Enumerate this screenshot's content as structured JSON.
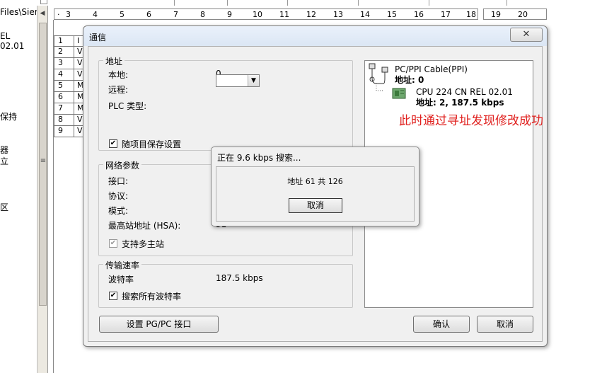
{
  "background": {
    "path_fragment": "Files\\Siem",
    "side_labels": [
      "EL 02.01",
      "保持",
      "器",
      "立",
      "区"
    ],
    "ruler_numbers": [
      "3",
      "4",
      "5",
      "6",
      "7",
      "8",
      "9",
      "10",
      "11",
      "12",
      "13",
      "14",
      "15",
      "16",
      "17",
      "18"
    ],
    "ruler_numbers_right": [
      "19",
      "20"
    ],
    "table_rows": [
      {
        "num": "1",
        "ch": "I"
      },
      {
        "num": "2",
        "ch": "V"
      },
      {
        "num": "3",
        "ch": "V"
      },
      {
        "num": "4",
        "ch": "V"
      },
      {
        "num": "5",
        "ch": "M"
      },
      {
        "num": "6",
        "ch": "M"
      },
      {
        "num": "7",
        "ch": "M"
      },
      {
        "num": "8",
        "ch": "V"
      },
      {
        "num": "9",
        "ch": "V"
      }
    ]
  },
  "dialog": {
    "title": "通信",
    "close_glyph": "✕",
    "address_group": {
      "legend": "地址",
      "local_label": "本地:",
      "local_value": "0",
      "remote_label": "远程:",
      "plc_type_label": "PLC 类型:",
      "save_with_project_label": "随项目保存设置",
      "save_with_project_checked": true
    },
    "network_group": {
      "legend": "网络参数",
      "interface_label": "接口:",
      "protocol_label": "协议:",
      "mode_label": "模式:",
      "hsa_label": "最高站地址 (HSA):",
      "hsa_value": "31",
      "multi_master_label": "支持多主站",
      "multi_master_checked": true
    },
    "rate_group": {
      "legend": "传输速率",
      "baud_label": "波特率",
      "baud_value": "187.5 kbps",
      "search_all_label": "搜索所有波特率",
      "search_all_checked": true
    },
    "tree": {
      "cable_label": "PC/PPI Cable(PPI)",
      "cable_address": "地址: 0",
      "cpu_label": "CPU 224 CN REL 02.01",
      "cpu_address": "地址: 2, 187.5 kbps"
    },
    "annotation": "此时通过寻址发现修改成功",
    "setup_button": "设置 PG/PC 接口",
    "ok_button": "确认",
    "cancel_button": "取消"
  },
  "search_popup": {
    "title": "正在 9.6 kbps 搜索...",
    "message": "地址 61 共 126",
    "cancel_button": "取消"
  },
  "colors": {
    "annotation": "#e0201e",
    "dialog_bg": "#f0f0f0",
    "titlebar": "#dbe6f4"
  }
}
